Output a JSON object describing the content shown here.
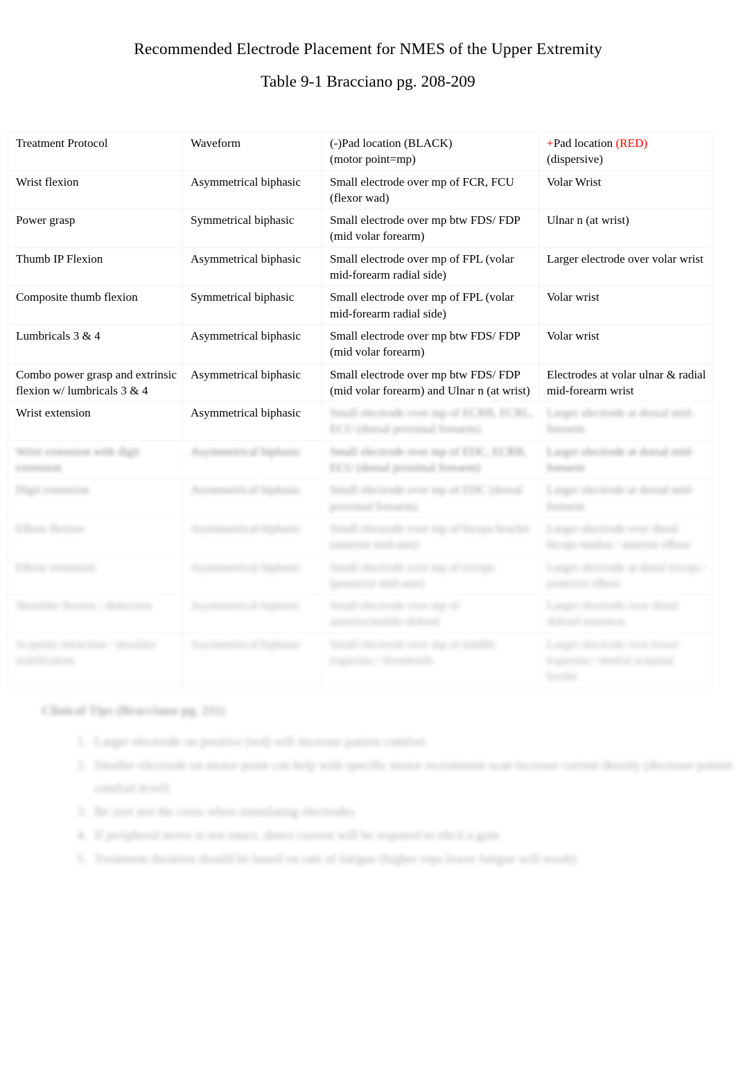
{
  "document": {
    "title": "Recommended Electrode Placement for NMES of the Upper Extremity",
    "subtitle": "Table 9-1 Bracciano pg. 208-209"
  },
  "colors": {
    "text": "#000000",
    "accent_red": "#FF0000",
    "page_background": "#FFFFFF",
    "table_border": "#EDEDED"
  },
  "table": {
    "columns": [
      {
        "key": "protocol",
        "header": "Treatment Protocol"
      },
      {
        "key": "waveform",
        "header": "Waveform"
      },
      {
        "key": "negative_pad",
        "header_line1": "(-)Pad location (BLACK)",
        "header_line2": "(motor point=mp)"
      },
      {
        "key": "positive_pad",
        "header_plus": "+",
        "header_line1_a": "Pad location ",
        "header_line1_red": "(RED)",
        "header_line2": "(dispersive)"
      }
    ],
    "rows": [
      {
        "protocol": "Wrist flexion",
        "waveform": "Asymmetrical biphasic",
        "negative_pad": "Small electrode over mp of FCR, FCU (flexor wad)",
        "positive_pad": "Volar Wrist",
        "blur": "b0"
      },
      {
        "protocol": "Power grasp",
        "waveform": "Symmetrical biphasic",
        "negative_pad": "Small electrode over mp btw FDS/ FDP (mid volar forearm)",
        "positive_pad": "Ulnar n (at wrist)",
        "blur": "b0"
      },
      {
        "protocol": "Thumb IP Flexion",
        "waveform": "Asymmetrical biphasic",
        "negative_pad": "Small electrode over mp of FPL (volar mid-forearm radial side)",
        "positive_pad": "Larger electrode over volar wrist",
        "blur": "b0"
      },
      {
        "protocol": "Composite thumb flexion",
        "waveform": "Symmetrical biphasic",
        "negative_pad": "Small electrode over mp of FPL (volar mid-forearm radial side)",
        "positive_pad": "Volar wrist",
        "blur": "b0"
      },
      {
        "protocol": "Lumbricals 3 & 4",
        "waveform": "Asymmetrical biphasic",
        "negative_pad": "Small electrode over mp btw FDS/ FDP (mid volar forearm)",
        "positive_pad": "Volar wrist",
        "blur": "b0"
      },
      {
        "protocol": "Combo power grasp and extrinsic flexion w/ lumbricals 3 & 4",
        "waveform": "Asymmetrical biphasic",
        "negative_pad": "Small electrode over mp btw FDS/ FDP (mid volar forearm) and Ulnar n (at wrist)",
        "positive_pad": "Electrodes at volar ulnar & radial mid-forearm wrist",
        "blur": "b0"
      },
      {
        "protocol": "Wrist extension",
        "waveform": "Asymmetrical biphasic",
        "negative_pad": "Small electrode over mp of ECRB, ECRL, ECU (dorsal proximal forearm)",
        "positive_pad": "Larger electrode at dorsal mid-forearm",
        "blur": "b2",
        "partial": true
      },
      {
        "protocol": "Wrist extension with digit extension",
        "waveform": "Asymmetrical biphasic",
        "negative_pad": "Small electrode over mp of EDC, ECRB, ECU (dorsal proximal forearm)",
        "positive_pad": "Larger electrode at dorsal mid-forearm",
        "blur": "b3"
      },
      {
        "protocol": "Digit extension",
        "waveform": "Asymmetrical biphasic",
        "negative_pad": "Small electrode over mp of EDC (dorsal proximal forearm)",
        "positive_pad": "Larger electrode at dorsal mid-forearm",
        "blur": "b4"
      },
      {
        "protocol": "Elbow flexion",
        "waveform": "Asymmetrical biphasic",
        "negative_pad": "Small electrode over mp of biceps brachii (anterior mid-arm)",
        "positive_pad": "Larger electrode over distal biceps tendon / anterior elbow",
        "blur": "b5"
      },
      {
        "protocol": "Elbow extension",
        "waveform": "Asymmetrical biphasic",
        "negative_pad": "Small electrode over mp of triceps (posterior mid-arm)",
        "positive_pad": "Larger electrode at distal triceps / posterior elbow",
        "blur": "b6"
      },
      {
        "protocol": "Shoulder flexion / abduction",
        "waveform": "Asymmetrical biphasic",
        "negative_pad": "Small electrode over mp of anterior/middle deltoid",
        "positive_pad": "Larger electrode over distal deltoid insertion",
        "blur": "b7"
      },
      {
        "protocol": "Scapular retraction / shoulder stabilization",
        "waveform": "Asymmetrical biphasic",
        "negative_pad": "Small electrode over mp of middle trapezius / rhomboids",
        "positive_pad": "Larger electrode over lower trapezius / medial scapular border",
        "blur": "b7"
      }
    ]
  },
  "notes": {
    "heading": "Clinical Tips (Bracciano pg. 211)",
    "items": [
      "Larger electrode on positive (red) will increase patient comfort",
      "Smaller electrode on motor point can help with specific motor recruitment scan increase current density (decrease patient comfort level)",
      "Be sure not the cross when stimulating electrodes",
      "If peripheral nerve is not intact, direct current will be required to elicit a gain",
      "Treatment duration should be based on rate of fatigue (higher reps lower fatigue will result)"
    ]
  }
}
